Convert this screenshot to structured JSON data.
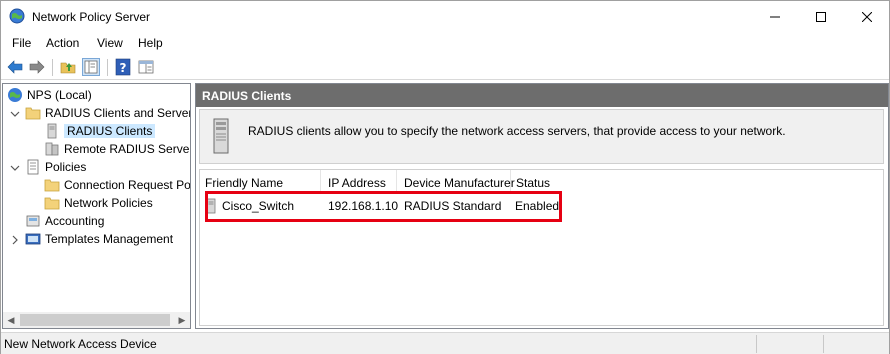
{
  "window": {
    "title": "Network Policy Server"
  },
  "menu": [
    "File",
    "Action",
    "View",
    "Help"
  ],
  "tree": {
    "root": "NPS (Local)",
    "radius_clients_servers": "RADIUS Clients and Servers",
    "radius_clients": "RADIUS Clients",
    "remote_radius": "Remote RADIUS Server",
    "policies": "Policies",
    "connection_request": "Connection Request Po",
    "network_policies": "Network Policies",
    "accounting": "Accounting",
    "templates": "Templates Management"
  },
  "right": {
    "header": "RADIUS Clients",
    "info": "RADIUS clients allow you to specify the network access servers, that provide access to your network.",
    "columns": [
      "Friendly Name",
      "IP Address",
      "Device Manufacturer",
      "Status"
    ],
    "rows": [
      {
        "name": "Cisco_Switch",
        "ip": "192.168.1.10",
        "manufacturer": "RADIUS Standard",
        "status": "Enabled"
      }
    ]
  },
  "status": {
    "text": "New Network Access Device"
  },
  "colors": {
    "highlight": "#e60012",
    "header_bg": "#6d6d6d",
    "selection": "#cce8ff"
  }
}
